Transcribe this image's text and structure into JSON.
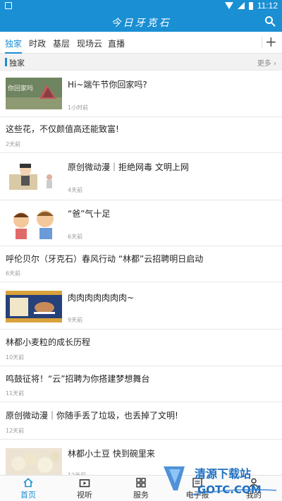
{
  "statusbar": {
    "time": "11:12"
  },
  "appbar": {
    "title": "今日牙克石"
  },
  "tabs": [
    {
      "label": "独家"
    },
    {
      "label": "时政"
    },
    {
      "label": "基层"
    },
    {
      "label": "现场云"
    },
    {
      "label": "直播"
    }
  ],
  "section": {
    "label": "独家",
    "more": "更多"
  },
  "news": [
    {
      "title": "Hi~端午节你回家吗?",
      "time": "1小时前"
    },
    {
      "title": "这些花，不仅颜值高还能致富!",
      "time": "2天前"
    },
    {
      "title": "原创微动漫｜拒绝网毒 文明上网",
      "time": "4天前"
    },
    {
      "title": "“爸”气十足",
      "time": "6天前"
    },
    {
      "title": "呼伦贝尔（牙克石）春风行动 “林都”云招聘明日启动",
      "time": "6天前"
    },
    {
      "title": "肉肉肉肉肉肉肉~",
      "time": "9天前"
    },
    {
      "title": "林都小麦粒的成长历程",
      "time": "10天前"
    },
    {
      "title": "鸣鼓征将！“云”招聘为你搭建梦想舞台",
      "time": "11天前"
    },
    {
      "title": "原创微动漫｜你随手丢了垃圾，也丢掉了文明!",
      "time": "12天前"
    },
    {
      "title": "林都小土豆 快到碗里来",
      "time": "12天前"
    }
  ],
  "thumbs": {
    "first_text": "你回家吗"
  },
  "bottom_nav": [
    {
      "label": "首页"
    },
    {
      "label": "视听"
    },
    {
      "label": "服务"
    },
    {
      "label": "电子报"
    },
    {
      "label": "我的"
    }
  ],
  "watermark": {
    "line1": "清源下载站",
    "line2": "GOTC.COM"
  },
  "colors": {
    "primary": "#1a8fd3",
    "text": "#222222",
    "muted": "#999999"
  }
}
